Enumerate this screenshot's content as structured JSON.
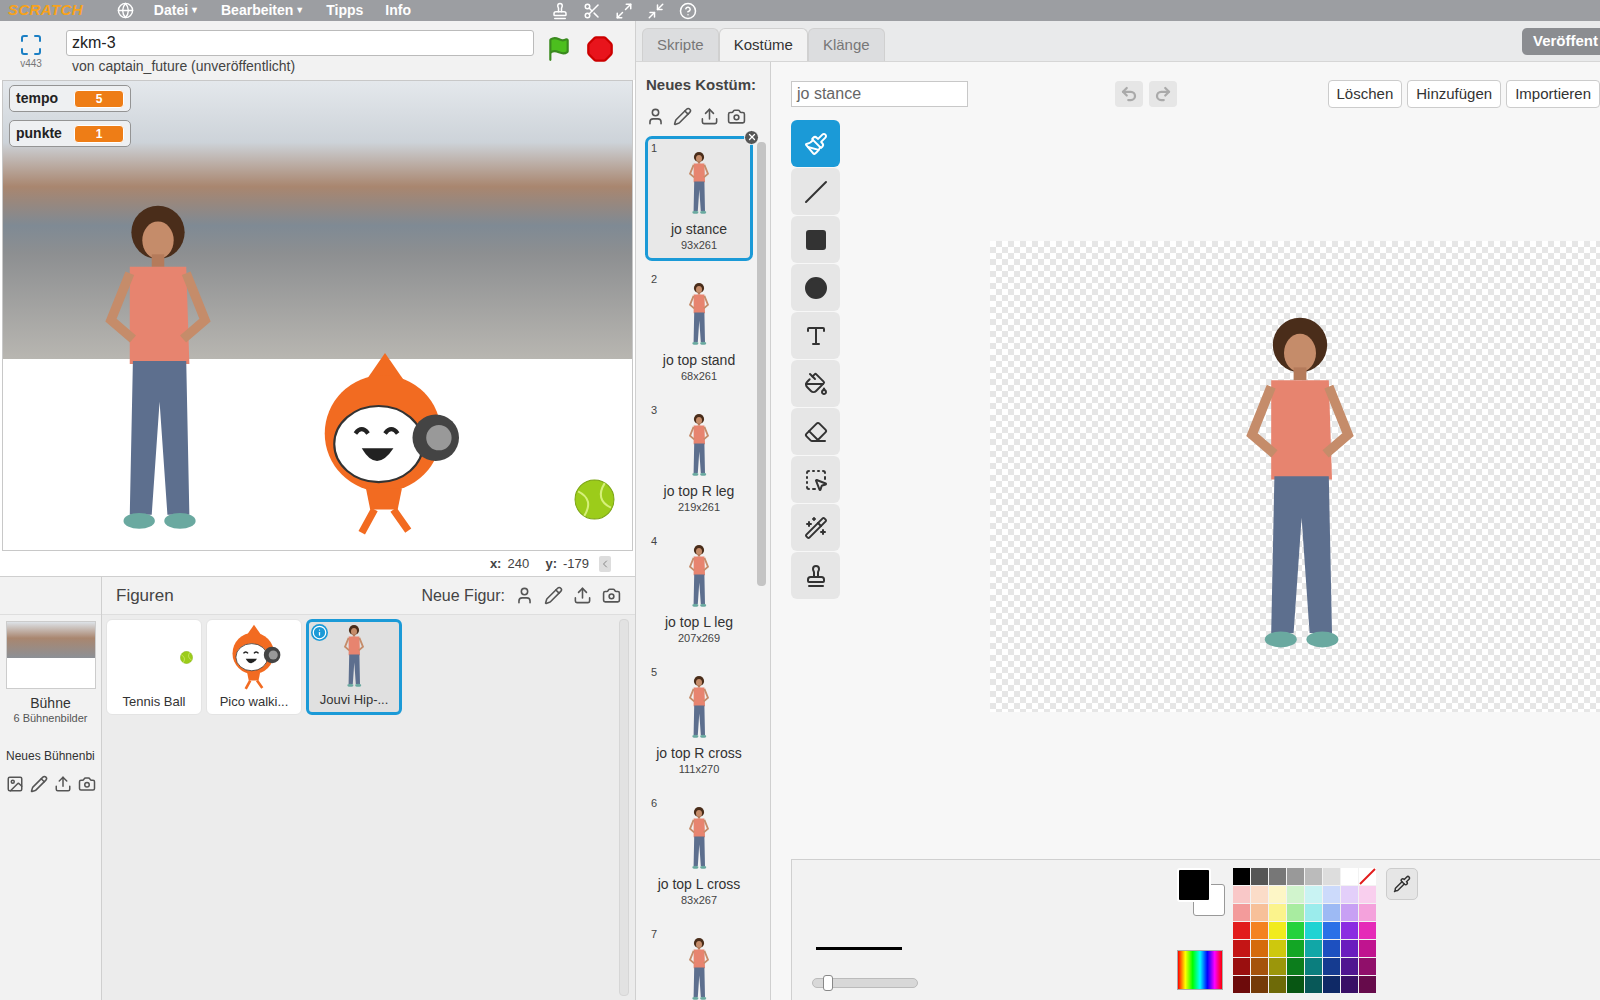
{
  "app": {
    "logo": "SCRATCH",
    "menu": [
      {
        "label": "Datei",
        "arrow": "▼"
      },
      {
        "label": "Bearbeiten",
        "arrow": "▼"
      },
      {
        "label": "Tipps",
        "arrow": ""
      },
      {
        "label": "Info",
        "arrow": ""
      }
    ]
  },
  "project": {
    "title": "zkm-3",
    "author": "von captain_future (unveröffentlicht)",
    "version": "v443"
  },
  "stage": {
    "monitors": [
      {
        "label": "tempo",
        "value": "5"
      },
      {
        "label": "punkte",
        "value": "1"
      }
    ],
    "mouse": {
      "x_label": "x:",
      "x": "240",
      "y_label": "y:",
      "y": "-179"
    }
  },
  "sprite_pane": {
    "stage_label": "Bühne",
    "backdrop_count": "6 Bühnenbilder",
    "new_backdrop": "Neues Bühnenbi",
    "title": "Figuren",
    "new_sprite": "Neue Figur:",
    "sprites": [
      {
        "name": "Tennis Ball",
        "kind": "ball",
        "selected": false
      },
      {
        "name": "Pico walki...",
        "kind": "pico",
        "selected": false
      },
      {
        "name": "Jouvi Hip-...",
        "kind": "person",
        "selected": true
      }
    ]
  },
  "editor": {
    "tabs": [
      {
        "label": "Skripte",
        "selected": false
      },
      {
        "label": "Kostüme",
        "selected": true
      },
      {
        "label": "Klänge",
        "selected": false
      }
    ],
    "publish_button": "Veröffent",
    "new_costume_label": "Neues Kostüm:",
    "costumes": [
      {
        "number": "1",
        "name": "jo stance",
        "size": "93x261",
        "selected": true
      },
      {
        "number": "2",
        "name": "jo top stand",
        "size": "68x261",
        "selected": false
      },
      {
        "number": "3",
        "name": "jo top R leg",
        "size": "219x261",
        "selected": false
      },
      {
        "number": "4",
        "name": "jo top L leg",
        "size": "207x269",
        "selected": false
      },
      {
        "number": "5",
        "name": "jo top R cross",
        "size": "111x270",
        "selected": false
      },
      {
        "number": "6",
        "name": "jo top L cross",
        "size": "83x267",
        "selected": false
      },
      {
        "number": "7",
        "name": "",
        "size": "",
        "selected": false
      }
    ],
    "costume_name": "jo stance",
    "buttons": [
      "Löschen",
      "Hinzufügen",
      "Importieren"
    ],
    "tools": [
      {
        "kind": "brush",
        "selected": true
      },
      {
        "kind": "line",
        "selected": false
      },
      {
        "kind": "rectangle",
        "selected": false
      },
      {
        "kind": "ellipse",
        "selected": false
      },
      {
        "kind": "text",
        "selected": false
      },
      {
        "kind": "fill",
        "selected": false
      },
      {
        "kind": "eraser",
        "selected": false
      },
      {
        "kind": "select",
        "selected": false
      },
      {
        "kind": "magic",
        "selected": false
      },
      {
        "kind": "stamp",
        "selected": false
      }
    ],
    "colors": {
      "primary": "#000000",
      "secondary": "#ffffff"
    },
    "line_width": {
      "level": 0.14
    },
    "swatches": [
      "#000000",
      "#555555",
      "#777777",
      "#999999",
      "#bbbbbb",
      "#dddddd",
      "#ffffff",
      "#f9c8c8",
      "#fbdcc8",
      "#fdf6c6",
      "#d1f4cd",
      "#c9f3f3",
      "#ccdafb",
      "#e3cffa",
      "#f9cfee",
      "#f39b9b",
      "#f7c099",
      "#fbf38c",
      "#a8eca0",
      "#9becec",
      "#9dbaf4",
      "#c8a0f4",
      "#f4a2dc",
      "#e21c1c",
      "#f48221",
      "#f1eb1d",
      "#24d23c",
      "#20d3d3",
      "#2b70e7",
      "#8b2ce1",
      "#e52bb8",
      "#c41515",
      "#d56b0c",
      "#cec80d",
      "#13a625",
      "#11a7a7",
      "#1d50c0",
      "#6a1cbe",
      "#c0148f",
      "#9a0f0f",
      "#a5530b",
      "#9b960b",
      "#0c7d1c",
      "#0b7e7e",
      "#153b90",
      "#501590",
      "#900f6a",
      "#6d0b0b",
      "#753b08",
      "#6e6a08",
      "#085613",
      "#085858",
      "#0f2966",
      "#390f66",
      "#660b4b"
    ]
  }
}
